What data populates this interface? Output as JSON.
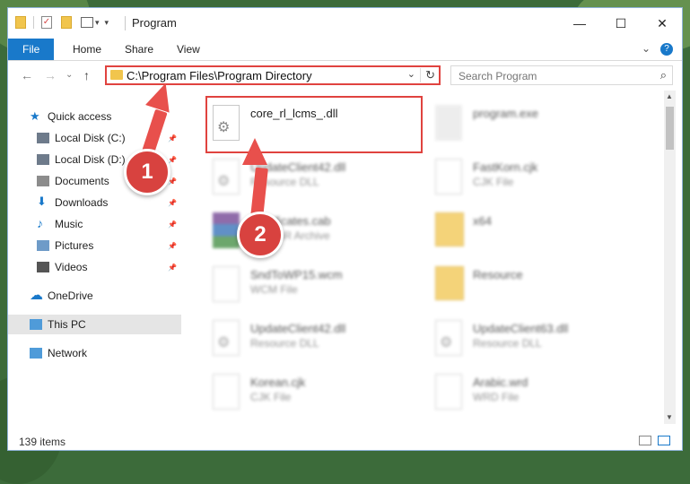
{
  "window": {
    "title": "Program",
    "controls": {
      "minimize": "—",
      "maximize": "☐",
      "close": "✕"
    }
  },
  "ribbon": {
    "tabs": [
      "File",
      "Home",
      "Share",
      "View"
    ],
    "help": "?"
  },
  "address_bar": {
    "path": "C:\\Program Files\\Program Directory",
    "dropdown": "⌄",
    "refresh": "↻"
  },
  "search": {
    "placeholder": "Search Program"
  },
  "nav_buttons": {
    "back": "←",
    "forward": "→",
    "history": "⌄",
    "up": "↑"
  },
  "nav_pane": {
    "items": [
      {
        "label": "Quick access",
        "icon": "star-icon",
        "color": "#1979ca"
      },
      {
        "label": "Local Disk (C:)",
        "icon": "drive-icon",
        "color": "#6e7b8b",
        "pinned": true
      },
      {
        "label": "Local Disk (D:)",
        "icon": "drive-icon",
        "color": "#6e7b8b",
        "pinned": true
      },
      {
        "label": "Documents",
        "icon": "documents-icon",
        "color": "#8c8c8c",
        "pinned": true
      },
      {
        "label": "Downloads",
        "icon": "downloads-icon",
        "color": "#1979ca",
        "pinned": true
      },
      {
        "label": "Music",
        "icon": "music-icon",
        "color": "#1979ca",
        "pinned": true
      },
      {
        "label": "Pictures",
        "icon": "pictures-icon",
        "color": "#6e9bc8",
        "pinned": true
      },
      {
        "label": "Videos",
        "icon": "videos-icon",
        "color": "#555555",
        "pinned": true
      },
      {
        "label": "OneDrive",
        "icon": "cloud-icon",
        "color": "#1979ca"
      },
      {
        "label": "This PC",
        "icon": "computer-icon",
        "color": "#4f9bd9",
        "selected": true
      },
      {
        "label": "Network",
        "icon": "network-icon",
        "color": "#4f9bd9"
      }
    ]
  },
  "files": [
    {
      "name": "core_rl_lcms_.dll",
      "type": "",
      "icon": "gear"
    },
    {
      "name": "program.exe",
      "type": "",
      "icon": "exe"
    },
    {
      "name": "UpdateClient42.dll",
      "type": "Resource DLL",
      "icon": "gear"
    },
    {
      "name": "FastKorn.cjk",
      "type": "CJK File",
      "icon": "doc"
    },
    {
      "name": "Certificates.cab",
      "type": "WinRAR Archive",
      "icon": "archive"
    },
    {
      "name": "x64",
      "type": "",
      "icon": "folder"
    },
    {
      "name": "SndToWP15.wcm",
      "type": "WCM File",
      "icon": "doc"
    },
    {
      "name": "Resource",
      "type": "",
      "icon": "folder"
    },
    {
      "name": "UpdateClient42.dll",
      "type": "Resource DLL",
      "icon": "gear"
    },
    {
      "name": "UpdateClient63.dll",
      "type": "Resource DLL",
      "icon": "gear"
    },
    {
      "name": "Korean.cjk",
      "type": "CJK File",
      "icon": "doc"
    },
    {
      "name": "Arabic.wrd",
      "type": "WRD File",
      "icon": "doc"
    }
  ],
  "status": {
    "item_count": "139 items"
  },
  "annotations": {
    "step1": "1",
    "step2": "2",
    "color": "#e0433f"
  }
}
